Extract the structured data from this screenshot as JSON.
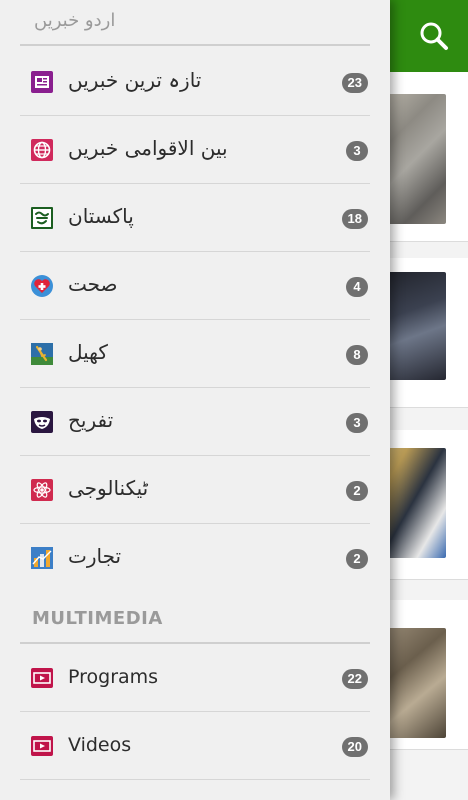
{
  "drawer": {
    "urdu_section": {
      "title": "اردو خبریں",
      "items": [
        {
          "label": "تازہ ترین خبریں",
          "count": "23",
          "icon": "newspaper-icon",
          "icon_color": "#8a1f8f"
        },
        {
          "label": "بین الاقوامی خبریں",
          "count": "3",
          "icon": "globe-icon",
          "icon_color": "#d0295c"
        },
        {
          "label": "پاکستان",
          "count": "18",
          "icon": "pakistan-emblem-icon",
          "icon_color": "#1b5e20"
        },
        {
          "label": "صحت",
          "count": "4",
          "icon": "heart-health-icon",
          "icon_color": "#3b90d8"
        },
        {
          "label": "کھیل",
          "count": "8",
          "icon": "sports-icon",
          "icon_color": "#2d6fa8"
        },
        {
          "label": "تفریح",
          "count": "3",
          "icon": "entertainment-mask-icon",
          "icon_color": "#2a1640"
        },
        {
          "label": "ٹیکنالوجی",
          "count": "2",
          "icon": "atom-icon",
          "icon_color": "#d02a4f"
        },
        {
          "label": "تجارت",
          "count": "2",
          "icon": "business-chart-icon",
          "icon_color": "#3c7fc7"
        }
      ]
    },
    "multimedia_section": {
      "title": "MULTIMEDIA",
      "items": [
        {
          "label": "Programs",
          "count": "22",
          "icon": "video-programs-icon",
          "icon_color": "#c0144a"
        },
        {
          "label": "Videos",
          "count": "20",
          "icon": "video-icon",
          "icon_color": "#c0144a"
        }
      ]
    }
  },
  "app_bar": {
    "color": "#2e8b10",
    "search_icon": "search-icon"
  }
}
